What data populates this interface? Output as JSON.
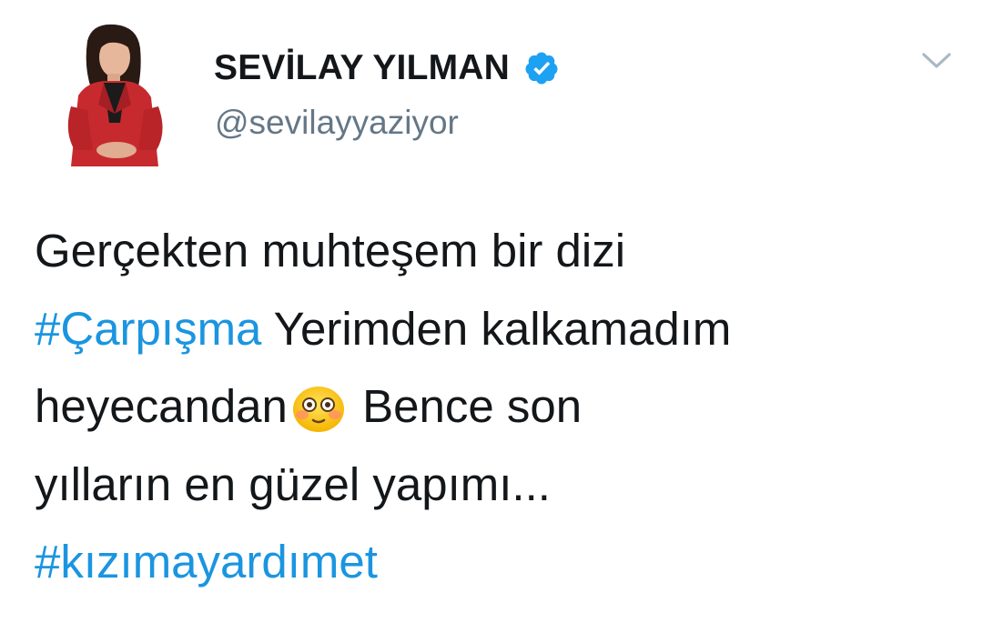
{
  "tweet": {
    "author": {
      "display_name": "SEVİLAY YILMAN",
      "handle": "@sevilayyaziyor",
      "verified": true,
      "avatar_icon": "avatar-photo"
    },
    "menu_icon": "chevron-down-icon",
    "text_lines": {
      "line1": "Gerçekten muhteşem bir dizi",
      "line2_hashtag": "#Çarpışma",
      "line2_text": " Yerimden kalkamadım",
      "line3_before_emoji": "heyecandan",
      "line3_emoji": "flushed-face-emoji",
      "line3_after_emoji": " Bence son",
      "line4": "yılların en güzel yapımı...",
      "line5_hashtag": "#kızımayardımet"
    },
    "colors": {
      "text": "#14171a",
      "secondary": "#657786",
      "link": "#1b95e0",
      "verified_badge": "#1da1f2"
    }
  }
}
